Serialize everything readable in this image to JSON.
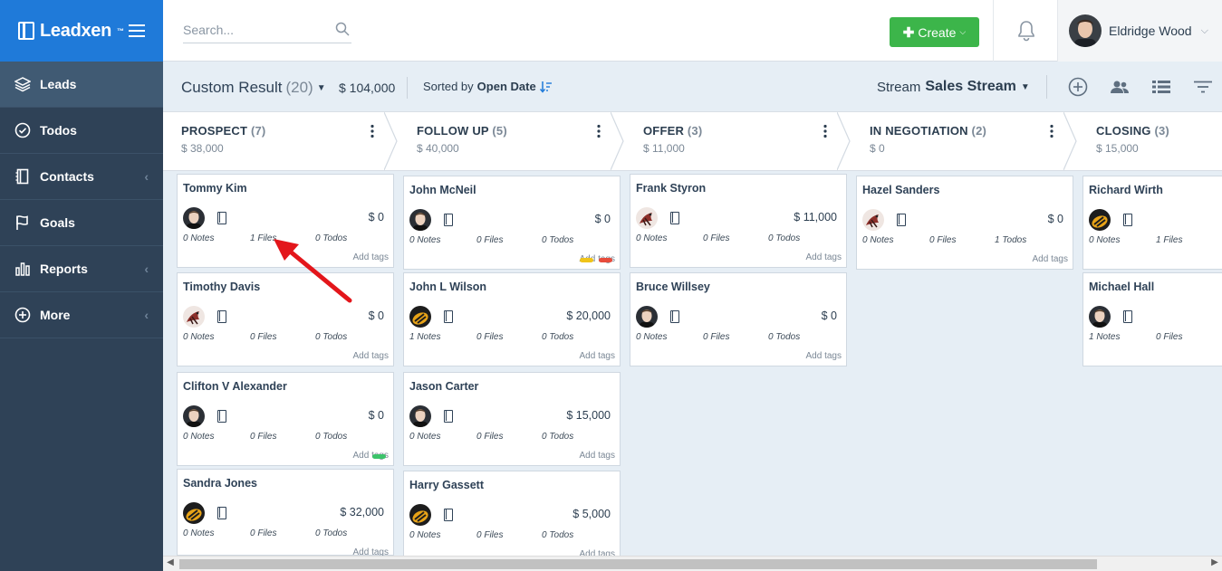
{
  "brand": {
    "name": "Leadxen",
    "tm": "™"
  },
  "sidebar": {
    "items": [
      {
        "label": "Leads",
        "icon": "layers-icon",
        "active": true,
        "chevron": false
      },
      {
        "label": "Todos",
        "icon": "check-circle-icon",
        "active": false,
        "chevron": false
      },
      {
        "label": "Contacts",
        "icon": "address-book-icon",
        "active": false,
        "chevron": true
      },
      {
        "label": "Goals",
        "icon": "flag-icon",
        "active": false,
        "chevron": false
      },
      {
        "label": "Reports",
        "icon": "bar-chart-icon",
        "active": false,
        "chevron": true
      },
      {
        "label": "More",
        "icon": "plus-circle-icon",
        "active": false,
        "chevron": true
      }
    ]
  },
  "topbar": {
    "search_placeholder": "Search...",
    "create_label": "Create",
    "user_name": "Eldridge Wood"
  },
  "subheader": {
    "title": "Custom Result",
    "count": "(20)",
    "amount": "$ 104,000",
    "sorted_prefix": "Sorted by",
    "sorted_field": "Open Date",
    "stream_prefix": "Stream",
    "stream_name": "Sales Stream"
  },
  "stages": [
    {
      "name": "PROSPECT",
      "count": "(7)",
      "amount": "$ 38,000"
    },
    {
      "name": "FOLLOW UP",
      "count": "(5)",
      "amount": "$ 40,000"
    },
    {
      "name": "OFFER",
      "count": "(3)",
      "amount": "$ 11,000"
    },
    {
      "name": "IN NEGOTIATION",
      "count": "(2)",
      "amount": "$ 0"
    },
    {
      "name": "CLOSING",
      "count": "(3)",
      "amount": "$ 15,000"
    }
  ],
  "add_tags_label": "Add tags",
  "columns": [
    [
      {
        "name": "Tommy Kim",
        "amount": "$ 0",
        "notes": "0 Notes",
        "files": "1 Files",
        "todos": "0 Todos",
        "avatar": "man",
        "tags": []
      },
      {
        "name": "Timothy Davis",
        "amount": "$ 0",
        "notes": "0 Notes",
        "files": "0 Files",
        "todos": "0 Todos",
        "avatar": "bird",
        "tags": []
      },
      {
        "name": "Clifton V Alexander",
        "amount": "$ 0",
        "notes": "0 Notes",
        "files": "0 Files",
        "todos": "0 Todos",
        "avatar": "man",
        "tags": [
          "#3cc36a"
        ]
      },
      {
        "name": "Sandra Jones",
        "amount": "$ 32,000",
        "notes": "0 Notes",
        "files": "0 Files",
        "todos": "0 Todos",
        "avatar": "bee",
        "tags": []
      }
    ],
    [
      {
        "name": "John McNeil",
        "amount": "$ 0",
        "notes": "0 Notes",
        "files": "0 Files",
        "todos": "0 Todos",
        "avatar": "man",
        "tags": [
          "#f0c419",
          "#e74c3c"
        ]
      },
      {
        "name": "John L Wilson",
        "amount": "$ 20,000",
        "notes": "1 Notes",
        "files": "0 Files",
        "todos": "0 Todos",
        "avatar": "bee",
        "tags": []
      },
      {
        "name": "Jason Carter",
        "amount": "$ 15,000",
        "notes": "0 Notes",
        "files": "0 Files",
        "todos": "0 Todos",
        "avatar": "man",
        "tags": []
      },
      {
        "name": "Harry Gassett",
        "amount": "$ 5,000",
        "notes": "0 Notes",
        "files": "0 Files",
        "todos": "0 Todos",
        "avatar": "bee",
        "tags": []
      }
    ],
    [
      {
        "name": "Frank Styron",
        "amount": "$ 11,000",
        "notes": "0 Notes",
        "files": "0 Files",
        "todos": "0 Todos",
        "avatar": "bird",
        "tags": []
      },
      {
        "name": "Bruce Willsey",
        "amount": "$ 0",
        "notes": "0 Notes",
        "files": "0 Files",
        "todos": "0 Todos",
        "avatar": "man",
        "tags": []
      }
    ],
    [
      {
        "name": "Hazel Sanders",
        "amount": "$ 0",
        "notes": "0 Notes",
        "files": "0 Files",
        "todos": "1 Todos",
        "avatar": "bird",
        "tags": []
      }
    ],
    [
      {
        "name": "Richard Wirth",
        "amount": "",
        "notes": "0 Notes",
        "files": "1 Files",
        "todos": "",
        "avatar": "bee",
        "tags": []
      },
      {
        "name": "Michael Hall",
        "amount": "",
        "notes": "1 Notes",
        "files": "0 Files",
        "todos": "",
        "avatar": "man",
        "tags": []
      }
    ]
  ],
  "colors": {
    "brand": "#1f7ad9",
    "sidebar": "#2f4257",
    "create": "#3cb54a",
    "annotation": "#e3161b"
  }
}
